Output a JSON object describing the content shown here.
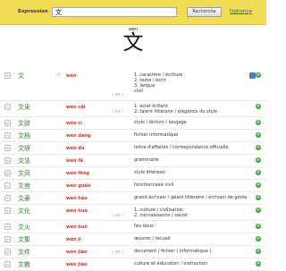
{
  "topbar": {
    "label": "Expression",
    "search_value": "文",
    "search_button": "Recherche",
    "options_label": "Options",
    "options_arrow": "▸"
  },
  "headword": {
    "pinyin": "wén",
    "hanzi": "文"
  },
  "rows": [
    {
      "hanzi": "文",
      "pinyin": "wén",
      "measure": "( ml. )",
      "defs": [
        "1. caractère / écriture",
        "2. texte / écrit",
        "3. langue",
        "civil"
      ],
      "speaker": "◁)"
    },
    {
      "hanzi": "文采",
      "pinyin": "wén cǎi",
      "measure": "( ml. )",
      "defs": [
        "1. éclat brillant",
        "2. talent littéraire / élégance du style"
      ]
    },
    {
      "hanzi": "文辞",
      "pinyin": "wén cí",
      "measure": "",
      "defs": [
        "style / diction / langage"
      ]
    },
    {
      "hanzi": "文档",
      "pinyin": "wén dàng",
      "measure": "",
      "defs": [
        "fichier informatique"
      ]
    },
    {
      "hanzi": "文牍",
      "pinyin": "wén dú",
      "measure": "",
      "defs": [
        "lettre d'affaires / correspondance officielle"
      ]
    },
    {
      "hanzi": "文法",
      "pinyin": "wén fǎ",
      "measure": "",
      "defs": [
        "grammaire"
      ]
    },
    {
      "hanzi": "文风",
      "pinyin": "wén fēng",
      "measure": "",
      "defs": [
        "style littéraire"
      ]
    },
    {
      "hanzi": "文官",
      "pinyin": "wén guān",
      "measure": "",
      "defs": [
        "fonctionnaire civil"
      ]
    },
    {
      "hanzi": "文豪",
      "pinyin": "wén háo",
      "measure": "",
      "defs": [
        "grand écrivain / géant littéraire / écrivain de génie"
      ]
    },
    {
      "hanzi": "文化",
      "pinyin": "wén huà",
      "measure": "( ml. )",
      "defs": [
        "1. culture / civilisation",
        "2. connaissance / savoir"
      ]
    },
    {
      "hanzi": "文火",
      "pinyin": "wén huǒ",
      "measure": "",
      "defs": [
        "feu doux"
      ]
    },
    {
      "hanzi": "文集",
      "pinyin": "wén jí",
      "measure": "",
      "defs": [
        "œuvres / recueil"
      ]
    },
    {
      "hanzi": "文件",
      "pinyin": "wén jiàn",
      "measure": "( ml. )",
      "defs": [
        "document / fichier ( informatique )"
      ]
    },
    {
      "hanzi": "文教",
      "pinyin": "wén jiào",
      "measure": "",
      "defs": [
        "culture et éducation / instruction"
      ]
    }
  ]
}
